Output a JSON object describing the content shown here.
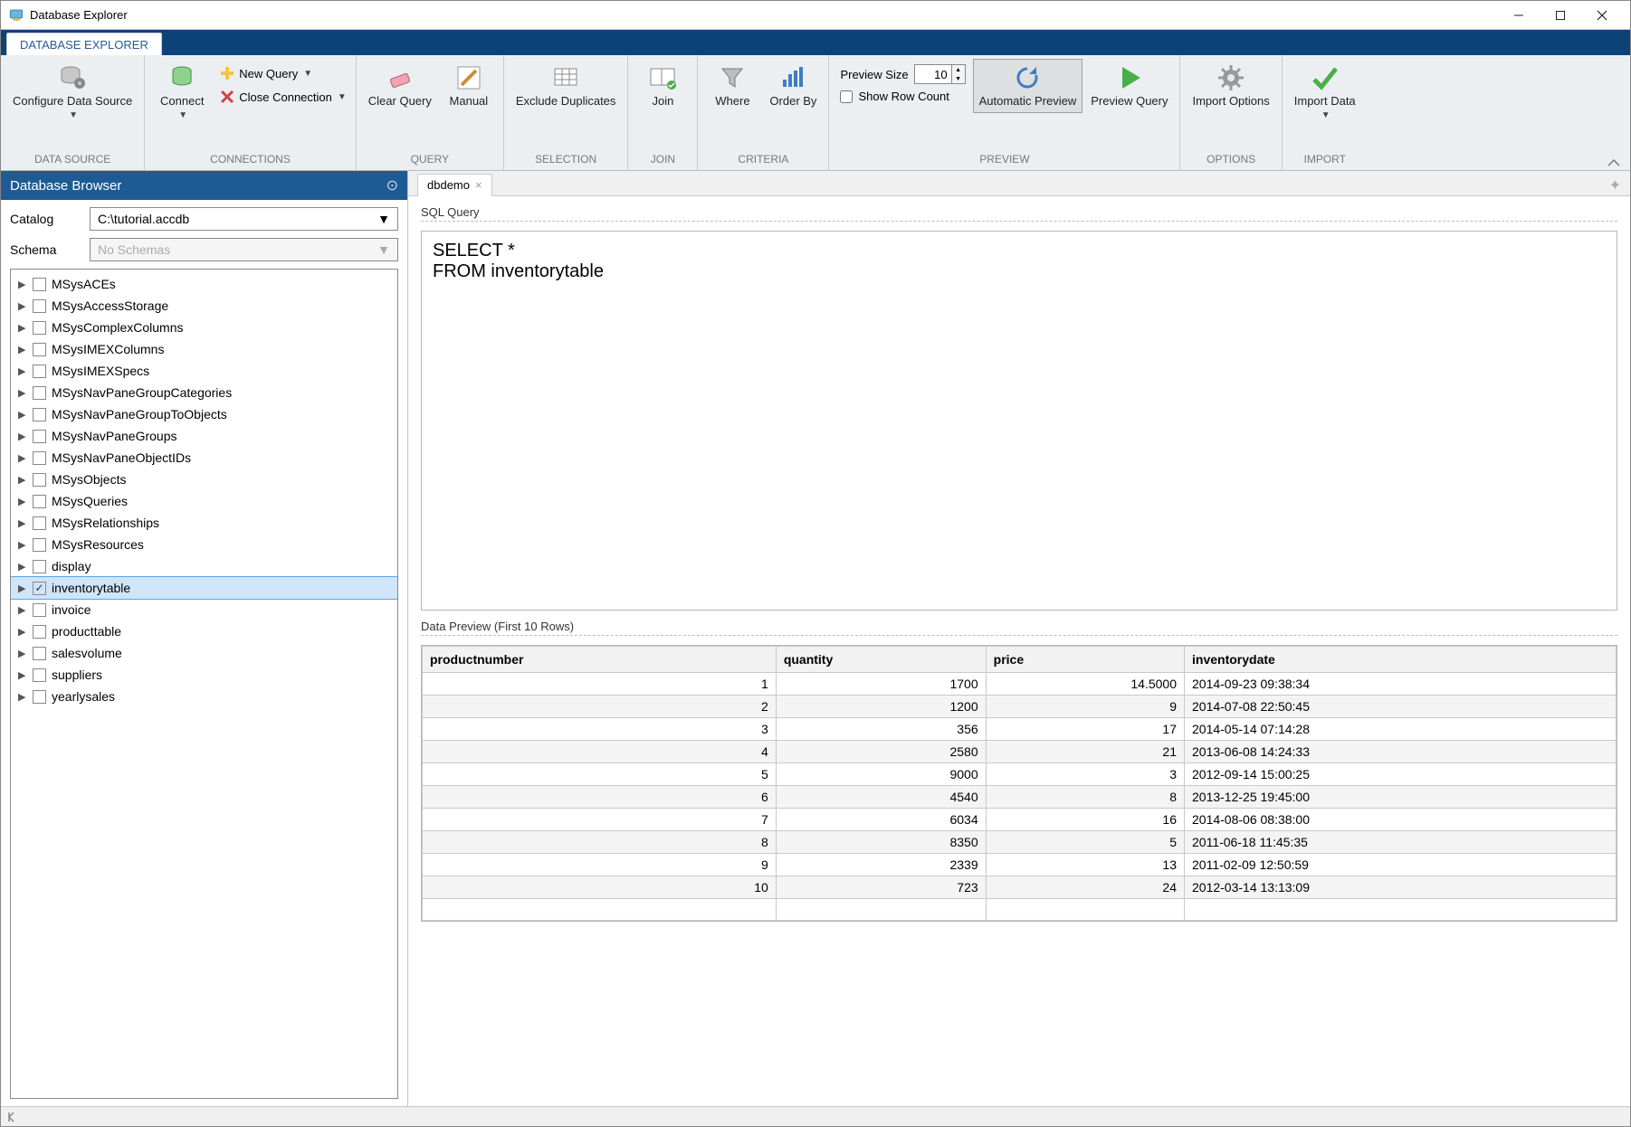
{
  "window": {
    "title": "Database Explorer"
  },
  "doc_tab": "DATABASE EXPLORER",
  "ribbon": {
    "groups": {
      "data_source": {
        "label": "DATA SOURCE",
        "configure": "Configure\nData Source"
      },
      "connections": {
        "label": "CONNECTIONS",
        "connect": "Connect",
        "new_query": "New Query",
        "close_conn": "Close Connection"
      },
      "query": {
        "label": "QUERY",
        "clear": "Clear\nQuery",
        "manual": "Manual"
      },
      "selection": {
        "label": "SELECTION",
        "exclude": "Exclude\nDuplicates"
      },
      "join": {
        "label": "JOIN",
        "join": "Join"
      },
      "criteria": {
        "label": "CRITERIA",
        "where": "Where",
        "orderby": "Order\nBy"
      },
      "preview": {
        "label": "PREVIEW",
        "size_label": "Preview Size",
        "size_value": "10",
        "row_count": "Show Row Count",
        "auto": "Automatic\nPreview",
        "preview_query": "Preview\nQuery"
      },
      "options": {
        "label": "OPTIONS",
        "import_options": "Import\nOptions"
      },
      "import": {
        "label": "IMPORT",
        "import_data": "Import\nData"
      }
    }
  },
  "browser": {
    "title": "Database Browser",
    "catalog_label": "Catalog",
    "catalog_value": "C:\\tutorial.accdb",
    "schema_label": "Schema",
    "schema_placeholder": "No Schemas",
    "tables": [
      {
        "name": "MSysACEs",
        "checked": false
      },
      {
        "name": "MSysAccessStorage",
        "checked": false
      },
      {
        "name": "MSysComplexColumns",
        "checked": false
      },
      {
        "name": "MSysIMEXColumns",
        "checked": false
      },
      {
        "name": "MSysIMEXSpecs",
        "checked": false
      },
      {
        "name": "MSysNavPaneGroupCategories",
        "checked": false
      },
      {
        "name": "MSysNavPaneGroupToObjects",
        "checked": false
      },
      {
        "name": "MSysNavPaneGroups",
        "checked": false
      },
      {
        "name": "MSysNavPaneObjectIDs",
        "checked": false
      },
      {
        "name": "MSysObjects",
        "checked": false
      },
      {
        "name": "MSysQueries",
        "checked": false
      },
      {
        "name": "MSysRelationships",
        "checked": false
      },
      {
        "name": "MSysResources",
        "checked": false
      },
      {
        "name": "display",
        "checked": false
      },
      {
        "name": "inventorytable",
        "checked": true,
        "selected": true
      },
      {
        "name": "invoice",
        "checked": false
      },
      {
        "name": "producttable",
        "checked": false
      },
      {
        "name": "salesvolume",
        "checked": false
      },
      {
        "name": "suppliers",
        "checked": false
      },
      {
        "name": "yearlysales",
        "checked": false
      }
    ]
  },
  "editor": {
    "tab_name": "dbdemo",
    "sql_label": "SQL Query",
    "sql_text": "SELECT *\nFROM inventorytable",
    "preview_label": "Data Preview (First 10 Rows)",
    "columns": [
      "productnumber",
      "quantity",
      "price",
      "inventorydate"
    ],
    "rows": [
      [
        "1",
        "1700",
        "14.5000",
        "2014-09-23 09:38:34"
      ],
      [
        "2",
        "1200",
        "9",
        "2014-07-08 22:50:45"
      ],
      [
        "3",
        "356",
        "17",
        "2014-05-14 07:14:28"
      ],
      [
        "4",
        "2580",
        "21",
        "2013-06-08 14:24:33"
      ],
      [
        "5",
        "9000",
        "3",
        "2012-09-14 15:00:25"
      ],
      [
        "6",
        "4540",
        "8",
        "2013-12-25 19:45:00"
      ],
      [
        "7",
        "6034",
        "16",
        "2014-08-06 08:38:00"
      ],
      [
        "8",
        "8350",
        "5",
        "2011-06-18 11:45:35"
      ],
      [
        "9",
        "2339",
        "13",
        "2011-02-09 12:50:59"
      ],
      [
        "10",
        "723",
        "24",
        "2012-03-14 13:13:09"
      ]
    ]
  }
}
